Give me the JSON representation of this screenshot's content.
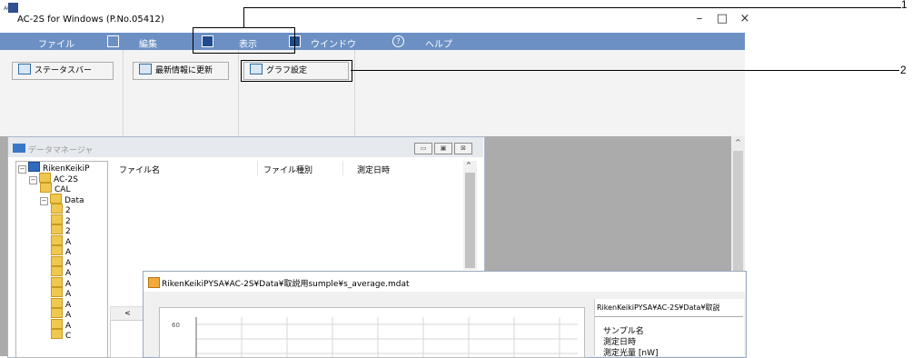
{
  "window": {
    "title": "AC-2S for Windows (P.No.05412)",
    "icon_label": "AC2S",
    "controls": [
      "–",
      "□",
      "×"
    ]
  },
  "menubar": {
    "items": [
      {
        "label": "ファイル",
        "icon": "folder-icon"
      },
      {
        "label": "編集",
        "icon": "document-icon"
      },
      {
        "label": "表示",
        "icon": "view-icon"
      },
      {
        "label": "ウインドウ",
        "icon": "window-icon"
      },
      {
        "label": "ヘルプ",
        "icon": "help-icon"
      }
    ]
  },
  "ribbon": {
    "status_bar_label": "ステータスバー",
    "refresh_label": "最新情報に更新",
    "graph_settings_label": "グラフ設定"
  },
  "data_manager": {
    "title": "データマネージャ",
    "controls": [
      "▭",
      "▣",
      "⊠"
    ],
    "tree": [
      {
        "label": "RikenKeikiP",
        "level": 0,
        "type": "computer"
      },
      {
        "label": "AC-2S",
        "level": 1,
        "type": "folder"
      },
      {
        "label": "CAL",
        "level": 2,
        "type": "folder"
      },
      {
        "label": "Data",
        "level": 2,
        "type": "folder"
      },
      {
        "label": "2",
        "level": 3,
        "type": "folder"
      },
      {
        "label": "2",
        "level": 3,
        "type": "folder"
      },
      {
        "label": "2",
        "level": 3,
        "type": "folder"
      },
      {
        "label": "A",
        "level": 3,
        "type": "folder"
      },
      {
        "label": "A",
        "level": 3,
        "type": "folder"
      },
      {
        "label": "A",
        "level": 3,
        "type": "folder"
      },
      {
        "label": "A",
        "level": 3,
        "type": "folder"
      },
      {
        "label": "A",
        "level": 3,
        "type": "folder"
      },
      {
        "label": "A",
        "level": 3,
        "type": "folder"
      },
      {
        "label": "A",
        "level": 3,
        "type": "folder"
      },
      {
        "label": "A",
        "level": 3,
        "type": "folder"
      },
      {
        "label": "A",
        "level": 3,
        "type": "folder"
      },
      {
        "label": "C",
        "level": 3,
        "type": "folder"
      }
    ],
    "columns": [
      "ファイル名",
      "ファイル種別",
      "測定日時"
    ],
    "hscroll_left": "<"
  },
  "graph_window": {
    "title": "RikenKeikiPYSA¥AC-2S¥Data¥取説用sumple¥s_average.mdat",
    "y_tick": "60",
    "info_header": "RikenKeikiPYSA¥AC-2S¥Data¥取説",
    "info_lines": [
      "サンプル名",
      "測定日時",
      "測定光量 [nW]"
    ]
  },
  "callouts": {
    "one": "1",
    "two": "2"
  },
  "colors": {
    "menubar": "#6c90c4",
    "workspace": "#ababab",
    "ribbon": "#f3f3f3"
  }
}
